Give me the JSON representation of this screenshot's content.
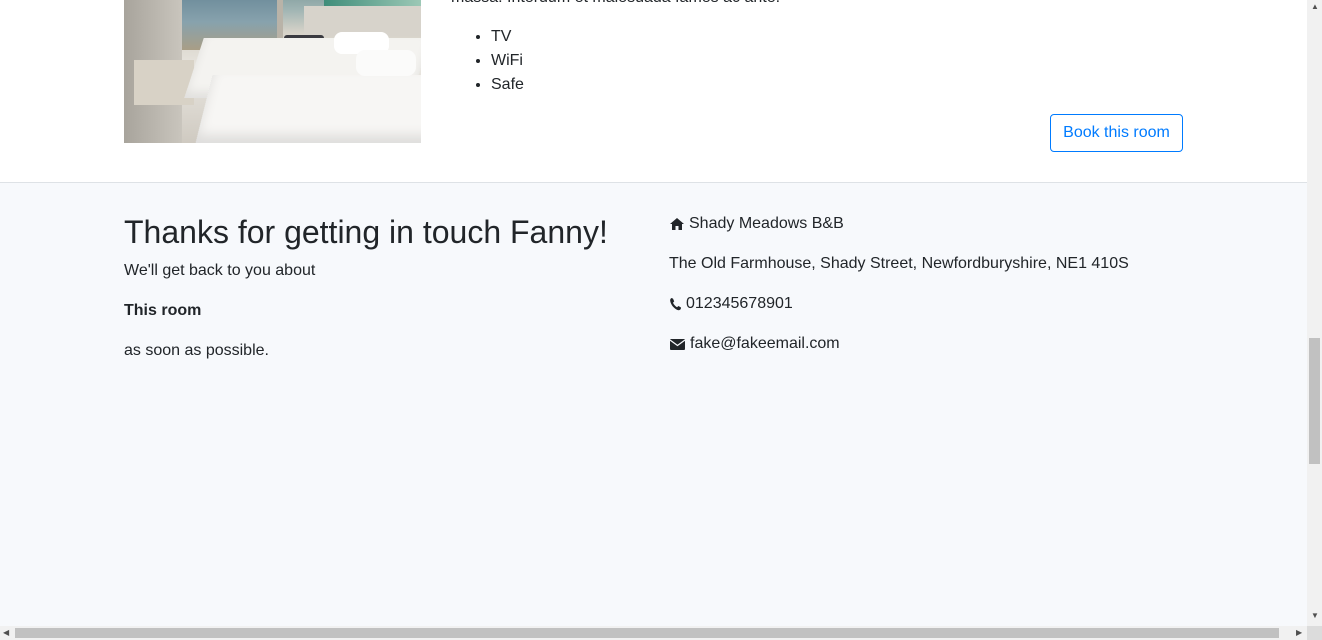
{
  "room": {
    "description_tail": "massa. Interdum et malesuada fames ac ante.",
    "amenities": [
      "TV",
      "WiFi",
      "Safe"
    ],
    "book_button_label": "Book this room"
  },
  "contact_confirmation": {
    "title": "Thanks for getting in touch Fanny!",
    "line1": "We'll get back to you about",
    "subject": "This room",
    "line3": "as soon as possible."
  },
  "business": {
    "name": "Shady Meadows B&B",
    "address": "The Old Farmhouse, Shady Street, Newfordburyshire, NE1 410S",
    "phone": "012345678901",
    "email": "fake@fakeemail.com",
    "icons": {
      "name": "home-icon",
      "phone": "phone-icon",
      "email": "envelope-icon"
    }
  },
  "colors": {
    "accent": "#007bff",
    "text": "#212529",
    "contact_bg": "#f7f9fc"
  }
}
